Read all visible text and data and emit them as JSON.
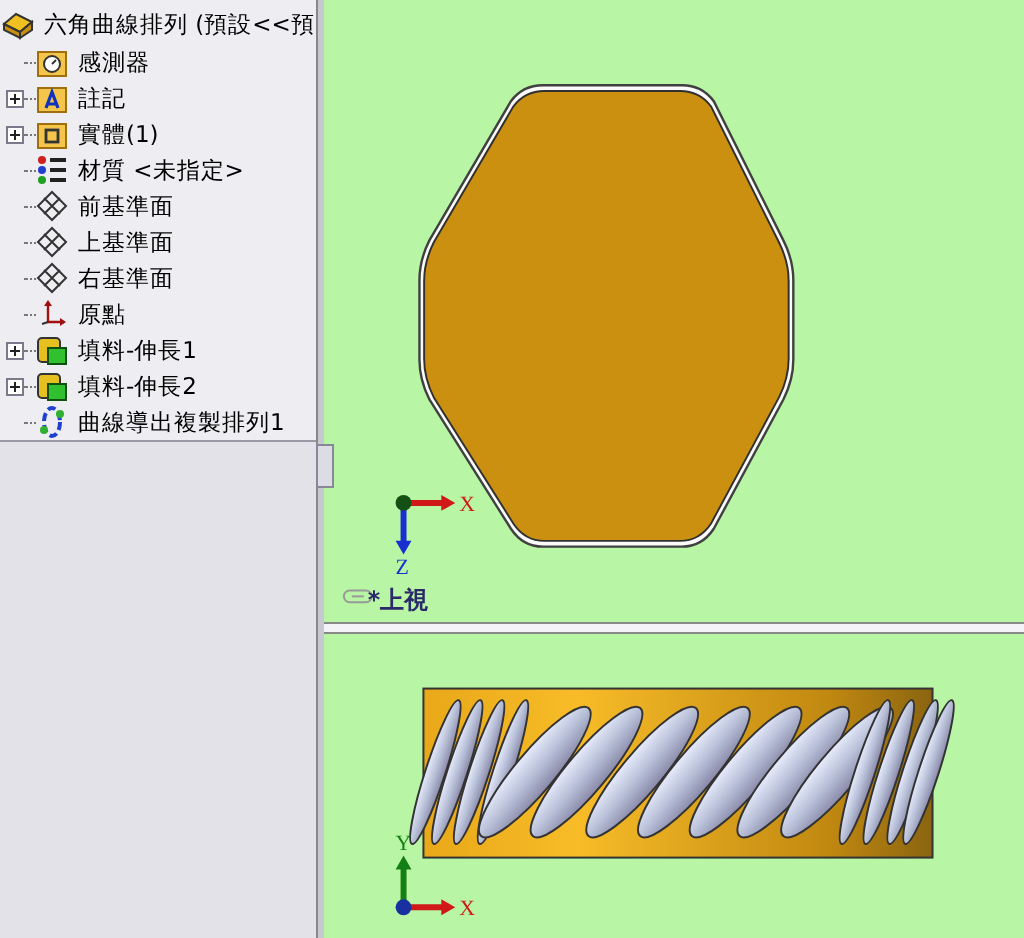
{
  "tree": {
    "root": {
      "label": "六角曲線排列 (預設<<預",
      "kind": "part"
    },
    "items": [
      {
        "label": "感測器",
        "kind": "sensor",
        "expandable": false
      },
      {
        "label": "註記",
        "kind": "annotation",
        "expandable": true
      },
      {
        "label": "實體(1)",
        "kind": "body",
        "expandable": true
      },
      {
        "label": "材質 <未指定>",
        "kind": "material",
        "expandable": false
      },
      {
        "label": "前基準面",
        "kind": "plane",
        "expandable": false
      },
      {
        "label": "上基準面",
        "kind": "plane",
        "expandable": false
      },
      {
        "label": "右基準面",
        "kind": "plane",
        "expandable": false
      },
      {
        "label": "原點",
        "kind": "origin",
        "expandable": false
      },
      {
        "label": "填料-伸長1",
        "kind": "extrude",
        "expandable": true
      },
      {
        "label": "填料-伸長2",
        "kind": "extrude",
        "expandable": true
      },
      {
        "label": "曲線導出複製排列1",
        "kind": "pattern",
        "expandable": false
      }
    ]
  },
  "viewports": [
    {
      "kind": "top",
      "label": "*上視",
      "axes": [
        {
          "label": "X",
          "kind": "x"
        },
        {
          "label": "Z",
          "kind": "z"
        }
      ]
    },
    {
      "kind": "front",
      "axes": [
        {
          "label": "Y",
          "kind": "y"
        },
        {
          "label": "X",
          "kind": "x"
        }
      ]
    }
  ]
}
